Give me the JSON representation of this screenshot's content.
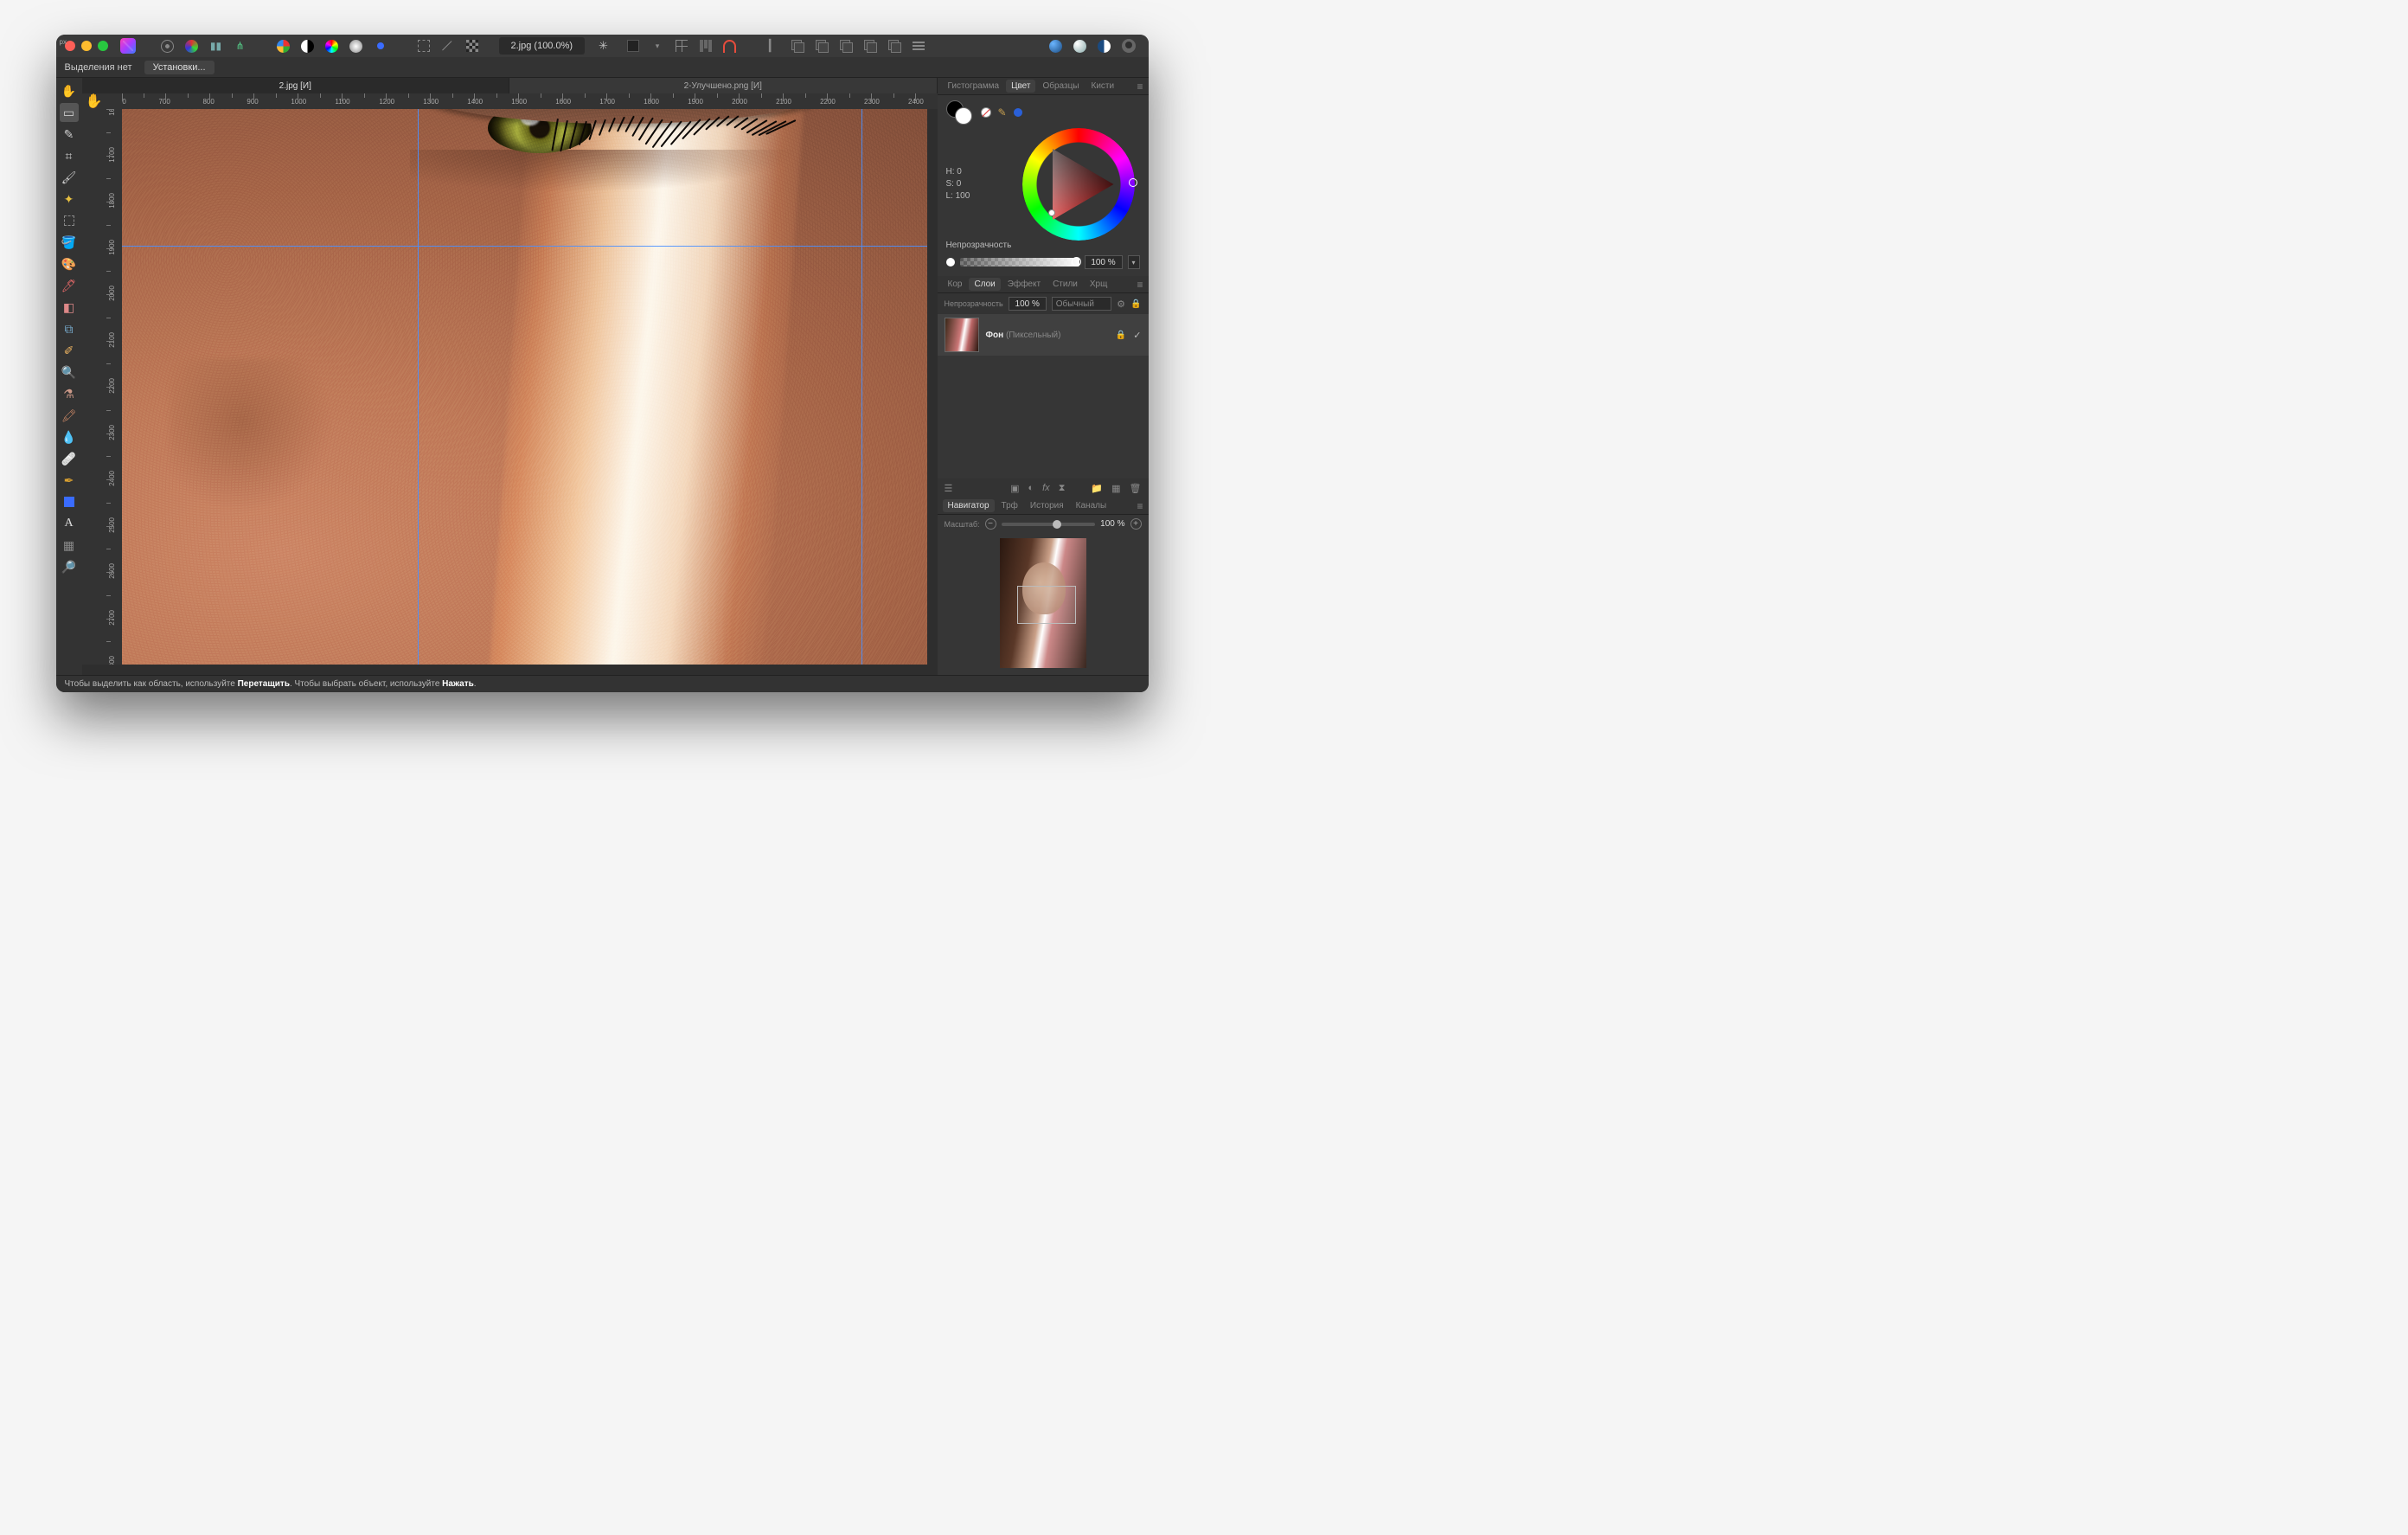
{
  "title": {
    "doc": "2.jpg (100.0%)"
  },
  "context": {
    "selection": "Выделения нет",
    "presets": "Установки..."
  },
  "tabs": [
    {
      "label": "2.jpg [И]",
      "active": true
    },
    {
      "label": "2-Улучшено.png [И]",
      "active": false
    }
  ],
  "ruler": {
    "unit": "px",
    "h_start": 600,
    "h_end": 2450,
    "h_step": 50,
    "h_label_step": 100,
    "v_start": 1600,
    "v_end": 2800,
    "v_step": 50,
    "v_label_step": 100
  },
  "guides": {
    "v": [
      1280,
      2300
    ],
    "h": [
      1895
    ]
  },
  "toolbar_icons": [
    "assets",
    "personas",
    "mirror",
    "share",
    "autolevels",
    "bw",
    "hue",
    "radial",
    "square-blue",
    "marquee",
    "diag",
    "checker",
    "dark-sq",
    "chev",
    "grid",
    "align",
    "magnet",
    "align2",
    "stack",
    "stack2",
    "stack3",
    "stack4",
    "stack5",
    "lines",
    "disc-blue",
    "disc-white",
    "disc-half",
    "avatar"
  ],
  "tools": [
    "hand",
    "move",
    "selection-brush",
    "crop",
    "brush",
    "color-picker",
    "marquee-rect",
    "flood",
    "mixer",
    "paint-brush",
    "erase",
    "clone",
    "dodge",
    "smudge",
    "blur",
    "sponge",
    "healing",
    "patch",
    "pen",
    "rectangle",
    "text",
    "mesh",
    "zoom"
  ],
  "right": {
    "color_tabs": [
      "Гистограмма",
      "Цвет",
      "Образцы",
      "Кисти"
    ],
    "color_active": "Цвет",
    "hsl": {
      "H": "H: 0",
      "S": "S: 0",
      "L": "L: 100"
    },
    "opacity_label": "Непрозрачность",
    "opacity_value": "100 %",
    "layer_tabs": [
      "Кор",
      "Слои",
      "Эффект",
      "Стили",
      "Хрщ"
    ],
    "layer_active": "Слои",
    "blend_label": "Непрозрачность",
    "blend_opacity": "100 %",
    "blend_mode": "Обычный",
    "layer": {
      "name": "Фон",
      "type": "(Пиксельный)"
    },
    "nav_tabs": [
      "Навигатор",
      "Трф",
      "История",
      "Каналы"
    ],
    "nav_active": "Навигатор",
    "zoom_label": "Масштаб:",
    "zoom_value": "100 %"
  },
  "status": {
    "pre1": "Чтобы выделить как область, используйте ",
    "b1": "Перетащить",
    "mid": ". Чтобы выбрать объект, используйте ",
    "b2": "Нажать",
    "post": "."
  }
}
